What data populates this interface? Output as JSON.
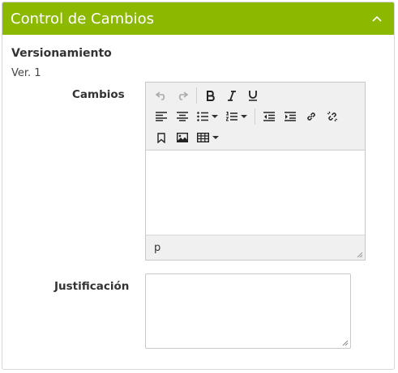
{
  "panel": {
    "title": "Control de Cambios"
  },
  "section": {
    "label": "Versionamiento",
    "version": "Ver. 1"
  },
  "fields": {
    "cambios_label": "Cambios",
    "justificacion_label": "Justificación",
    "justificacion_value": ""
  },
  "editor": {
    "status_path": "p",
    "content": ""
  },
  "toolbar": {
    "icons": [
      "undo-icon",
      "redo-icon",
      "bold-icon",
      "italic-icon",
      "underline-icon",
      "align-left-icon",
      "align-center-icon",
      "bullet-list-icon",
      "numbered-list-icon",
      "outdent-icon",
      "indent-icon",
      "link-icon",
      "unlink-icon",
      "bookmark-icon",
      "image-icon",
      "table-icon"
    ]
  },
  "colors": {
    "header": "#8cb800",
    "toolbar": "#f0f0f0"
  }
}
